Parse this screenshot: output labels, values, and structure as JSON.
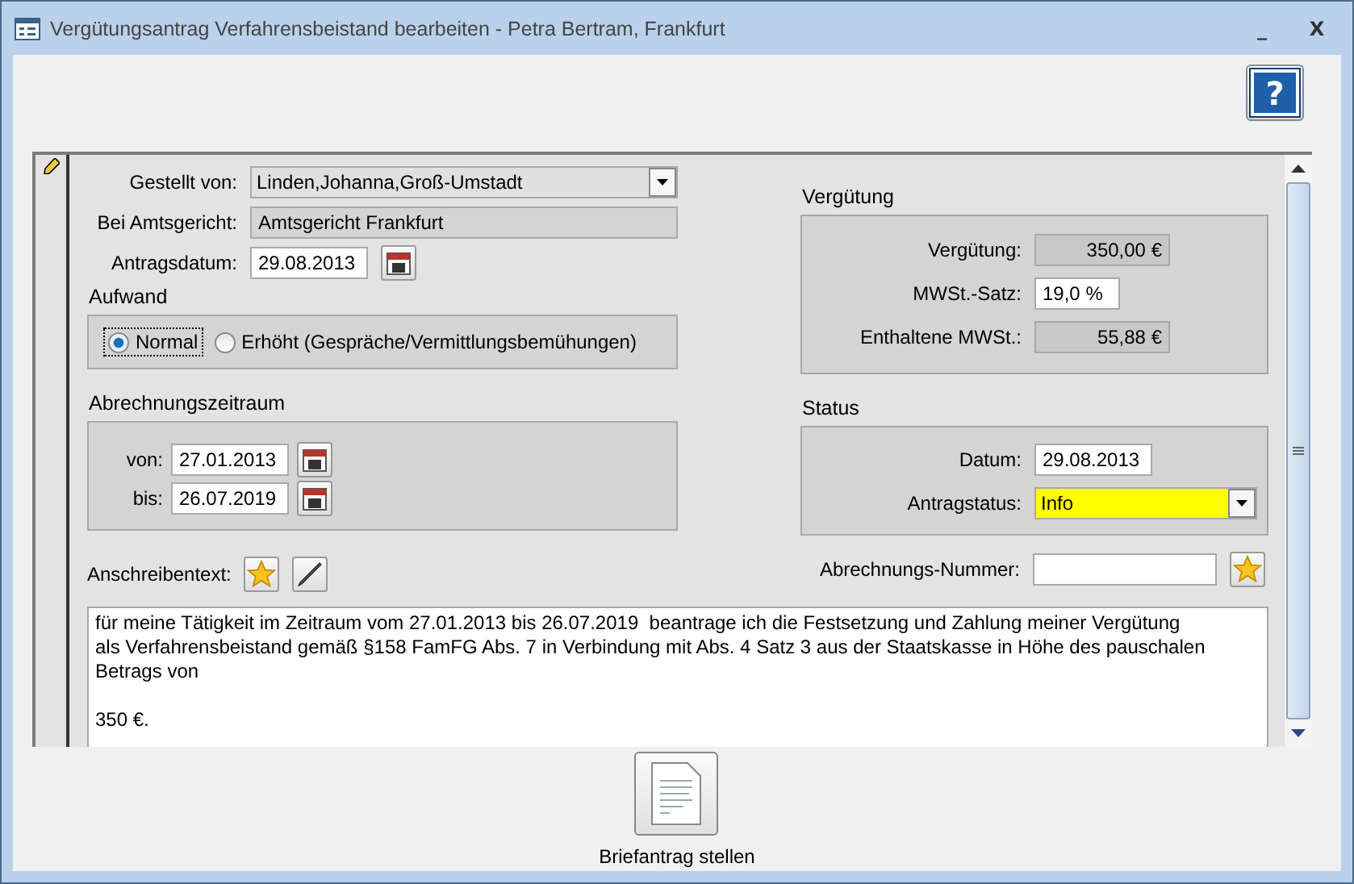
{
  "window": {
    "title": "Vergütungsantrag Verfahrensbeistand bearbeiten - Petra Bertram, Frankfurt",
    "minimize": "_",
    "close": "X"
  },
  "help_button": {
    "label": "?"
  },
  "form": {
    "gestellt_von": {
      "label": "Gestellt von:",
      "value": "Linden,Johanna,Groß-Umstadt"
    },
    "amtsgericht": {
      "label": "Bei Amtsgericht:",
      "value": "Amtsgericht Frankfurt"
    },
    "antragsdatum": {
      "label": "Antragsdatum:",
      "value": "29.08.2013"
    },
    "aufwand": {
      "title": "Aufwand",
      "options": [
        {
          "label": "Normal",
          "selected": true
        },
        {
          "label": "Erhöht (Gespräche/Vermittlungsbemühungen)",
          "selected": false
        }
      ]
    },
    "abrechnungszeitraum": {
      "title": "Abrechnungszeitraum",
      "von": {
        "label": "von:",
        "value": "27.01.2013"
      },
      "bis": {
        "label": "bis:",
        "value": "26.07.2019"
      }
    },
    "verguetung": {
      "title": "Vergütung",
      "rows": [
        {
          "label": "Vergütung:",
          "value": "350,00 €",
          "kind": "readonly"
        },
        {
          "label": "MWSt.-Satz:",
          "value": "19,0 %",
          "kind": "editable"
        },
        {
          "label": "Enthaltene MWSt.:",
          "value": "55,88 €",
          "kind": "readonly"
        }
      ]
    },
    "status": {
      "title": "Status",
      "datum": {
        "label": "Datum:",
        "value": "29.08.2013"
      },
      "antragstatus": {
        "label": "Antragstatus:",
        "value": "Info",
        "color": "#ffff00"
      }
    },
    "abrechnungs_nummer": {
      "label": "Abrechnungs-Nummer:"
    },
    "anschreibentext": {
      "label": "Anschreibentext:",
      "text": "für meine Tätigkeit im Zeitraum vom 27.01.2013 bis 26.07.2019  beantrage ich die Festsetzung und Zahlung meiner Vergütung\nals Verfahrensbeistand gemäß §158 FamFG Abs. 7 in Verbindung mit Abs. 4 Satz 3 aus der Staatskasse in Höhe des pauschalen\nBetrags von\n\n350 €."
    }
  },
  "footer": {
    "button": "Briefantrag stellen"
  }
}
